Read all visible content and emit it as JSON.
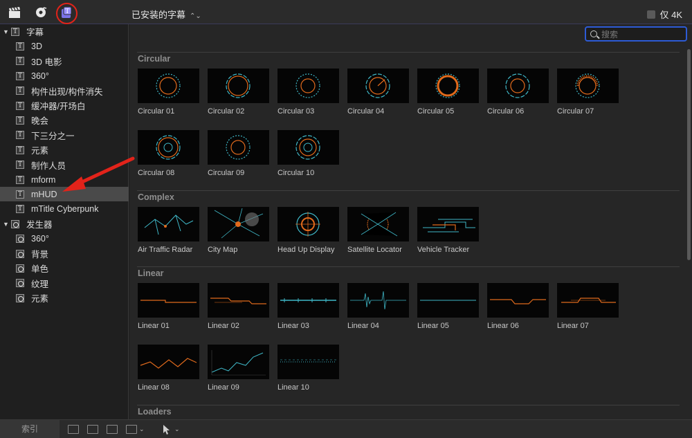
{
  "topbar": {
    "icons": [
      "clapper-icon",
      "photo-music-icon",
      "titles-generators-icon"
    ],
    "library_select": "已安装的字幕",
    "only_4k_label": "仅 4K",
    "annotation_color": "#e2231a"
  },
  "sidebar": {
    "groups": [
      {
        "label": "字幕",
        "icon": "title-T-icon",
        "items": [
          "3D",
          "3D 电影",
          "360°",
          "构件出现/构件消失",
          "缓冲器/开场白",
          "晚会",
          "下三分之一",
          "元素",
          "制作人员",
          "mform",
          "mHUD",
          "mTitle Cyberpunk"
        ],
        "selected": "mHUD"
      },
      {
        "label": "发生器",
        "icon": "generator-icon",
        "items": [
          "360°",
          "背景",
          "单色",
          "纹理",
          "元素"
        ]
      }
    ]
  },
  "search": {
    "placeholder": "搜索"
  },
  "sections": [
    {
      "title": "Circular",
      "items": [
        "Circular 01",
        "Circular 02",
        "Circular 03",
        "Circular 04",
        "Circular 05",
        "Circular 06",
        "Circular 07",
        "Circular 08",
        "Circular 09",
        "Circular 10"
      ]
    },
    {
      "title": "Complex",
      "items": [
        "Air Traffic Radar",
        "City Map",
        "Head Up Display",
        "Satellite Locator",
        "Vehicle Tracker"
      ]
    },
    {
      "title": "Linear",
      "items": [
        "Linear 01",
        "Linear 02",
        "Linear 03",
        "Linear 04",
        "Linear 05",
        "Linear 06",
        "Linear 07",
        "Linear 08",
        "Linear 09",
        "Linear 10"
      ]
    },
    {
      "title": "Loaders",
      "items": []
    }
  ],
  "bottombar": {
    "index_label": "索引"
  },
  "colors": {
    "accent_orange": "#e06a1c",
    "accent_cyan": "#3fb8c8",
    "search_border": "#2d5bd6"
  }
}
